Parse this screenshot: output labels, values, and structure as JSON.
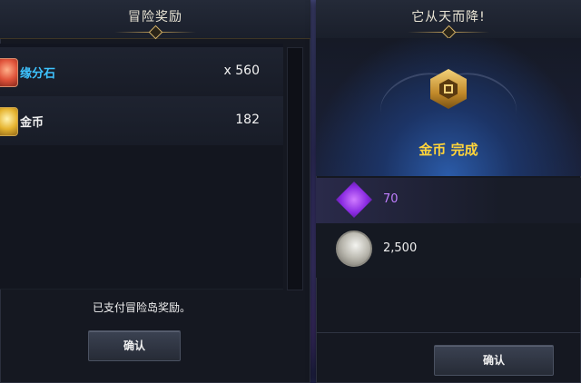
{
  "left_panel": {
    "title": "冒险奖励",
    "rewards": [
      {
        "name": "缘分石",
        "quantity": "x 560",
        "icon": "red-stone-icon"
      },
      {
        "name": "金币",
        "quantity": "182",
        "icon": "gold-coin-icon"
      }
    ],
    "message": "已支付冒险岛奖励。",
    "confirm_label": "确认"
  },
  "right_panel": {
    "title": "它从天而降!",
    "achievement": "金币 完成",
    "gains": [
      {
        "value": "70",
        "icon": "purple-crystal-icon"
      },
      {
        "value": "2,500",
        "icon": "silver-coin-icon"
      }
    ],
    "confirm_label": "确认"
  },
  "colors": {
    "item_name_highlight": "#3ec3ff",
    "achievement_gold": "#ffd43a",
    "crystal_purple": "#c07fff"
  }
}
